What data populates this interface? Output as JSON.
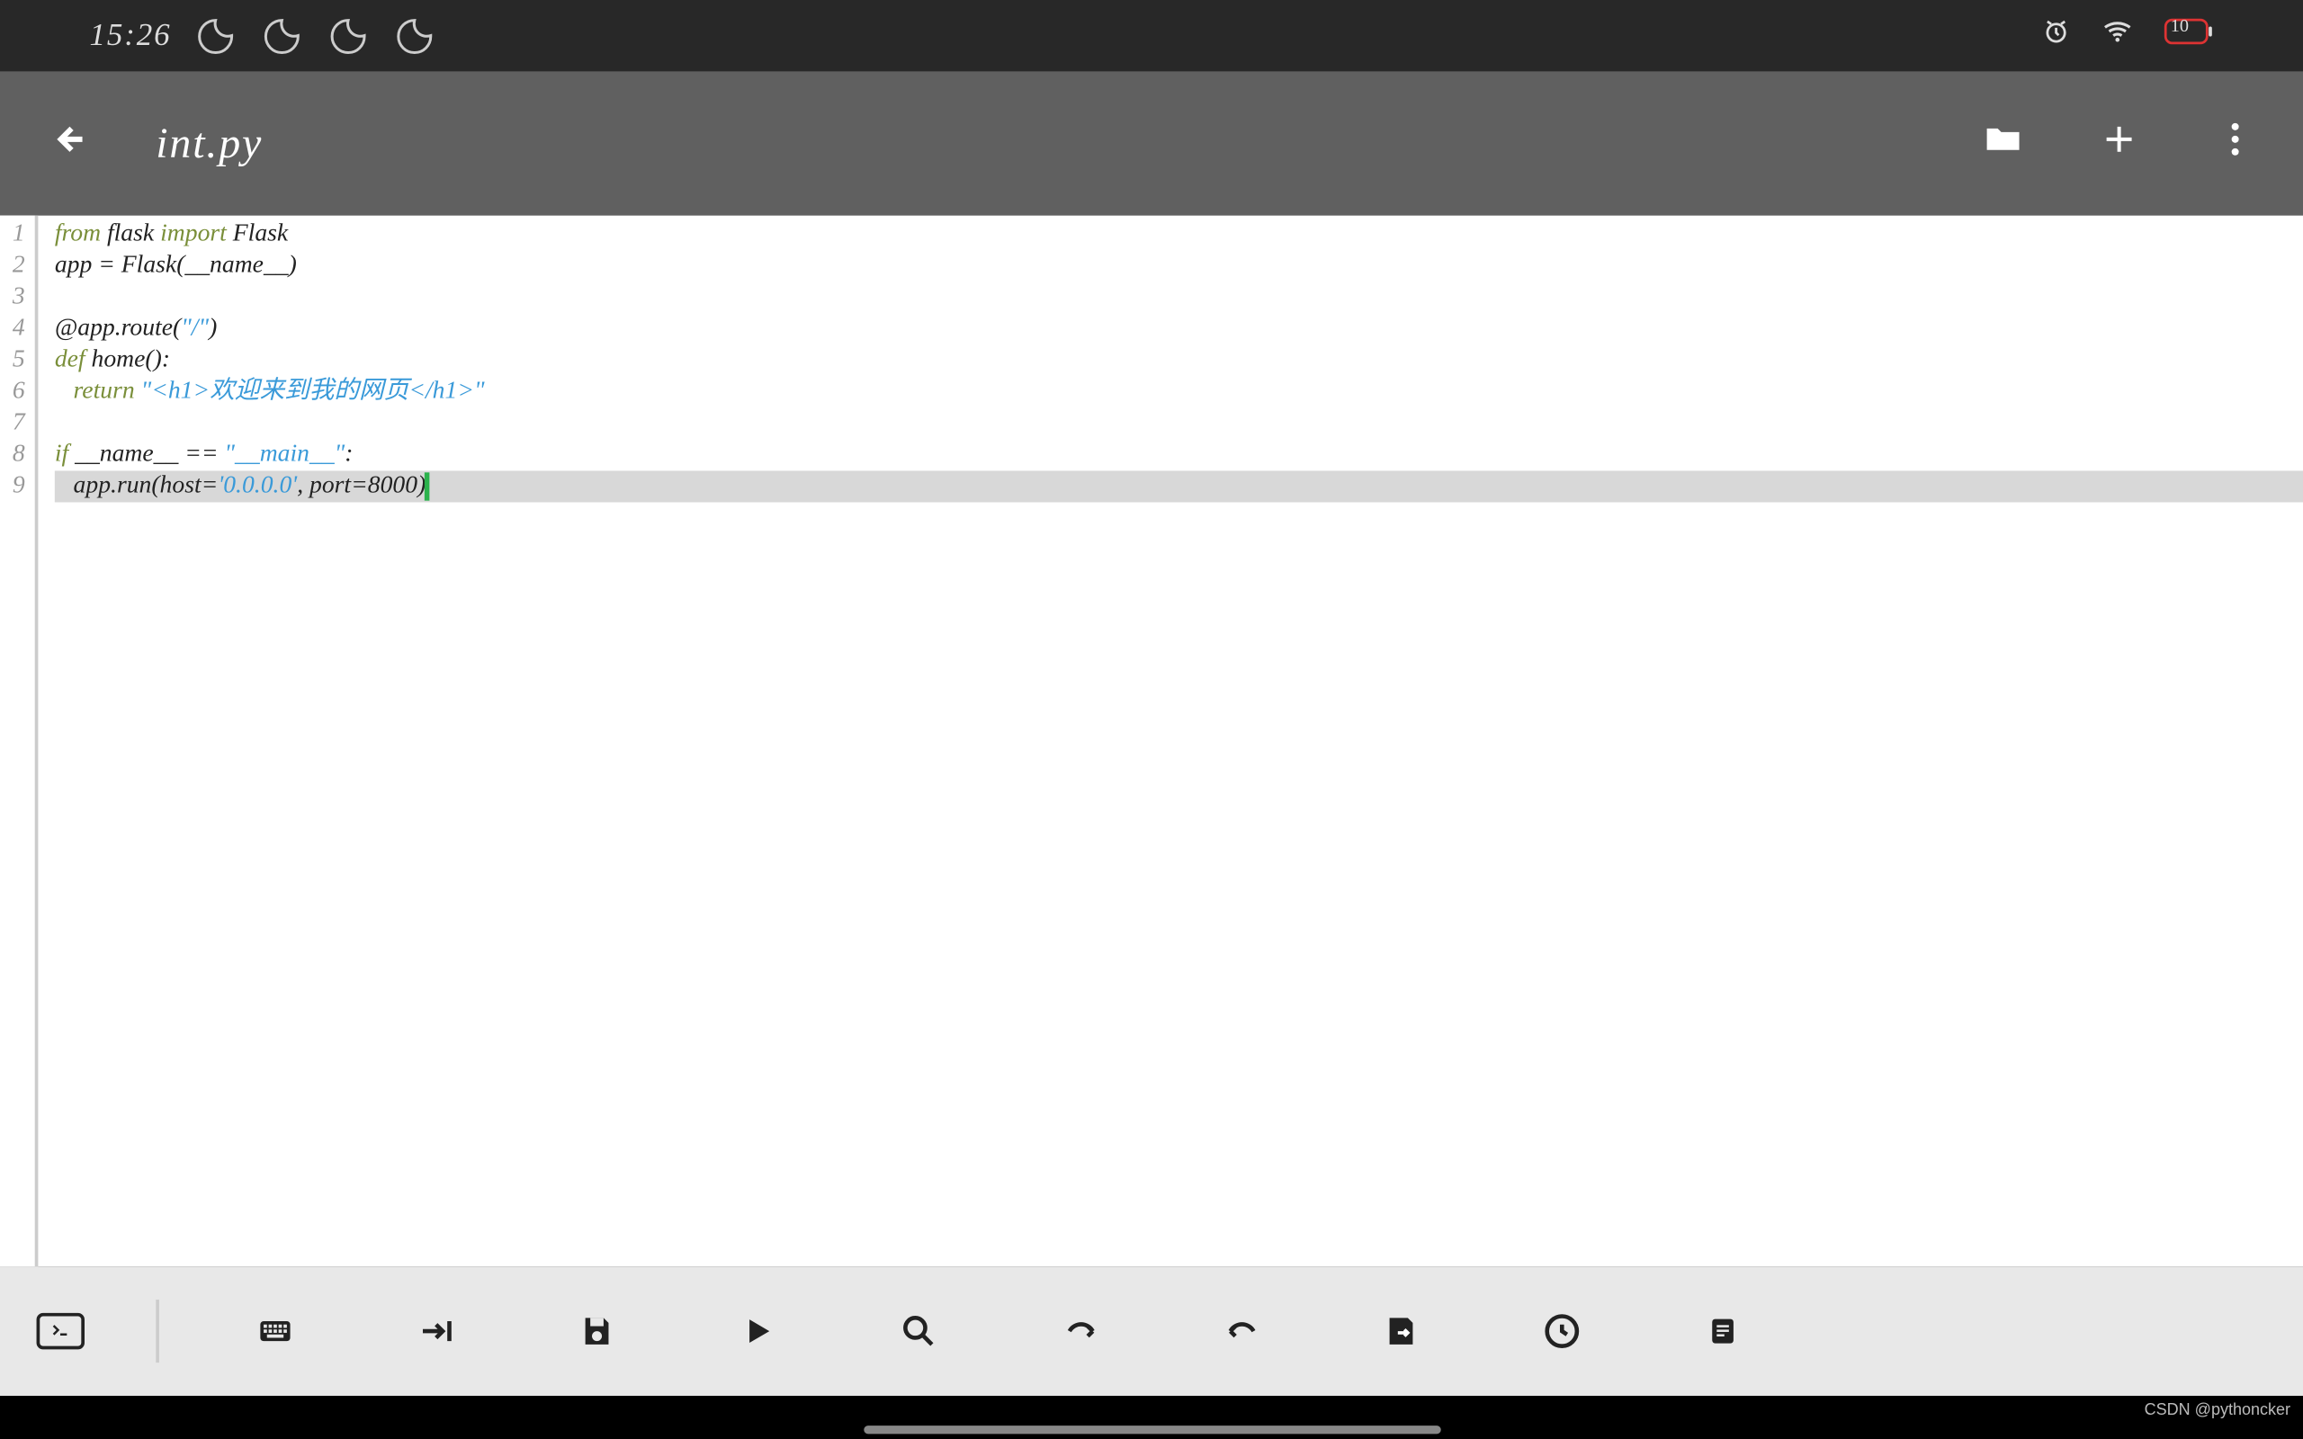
{
  "status": {
    "time": "15:26",
    "battery_level": "10",
    "icons": [
      "moon",
      "moon",
      "moon",
      "moon"
    ]
  },
  "header": {
    "filename": "int.py"
  },
  "editor": {
    "current_line": 9,
    "lines": [
      {
        "n": 1,
        "tokens": [
          [
            "kw1",
            "from"
          ],
          [
            "plain",
            " flask "
          ],
          [
            "kw1",
            "import"
          ],
          [
            "plain",
            " Flask"
          ]
        ]
      },
      {
        "n": 2,
        "tokens": [
          [
            "plain",
            "app = Flask(__name__)"
          ]
        ]
      },
      {
        "n": 3,
        "tokens": [
          [
            "plain",
            ""
          ]
        ]
      },
      {
        "n": 4,
        "tokens": [
          [
            "plain",
            "@app.route("
          ],
          [
            "str",
            "\"/\""
          ],
          [
            "plain",
            ")"
          ]
        ]
      },
      {
        "n": 5,
        "tokens": [
          [
            "kw1",
            "def"
          ],
          [
            "plain",
            " home():"
          ]
        ]
      },
      {
        "n": 6,
        "tokens": [
          [
            "plain",
            "   "
          ],
          [
            "kw1",
            "return"
          ],
          [
            "plain",
            " "
          ],
          [
            "str",
            "\"<h1>欢迎来到我的网页</h1>\""
          ]
        ]
      },
      {
        "n": 7,
        "tokens": [
          [
            "plain",
            ""
          ]
        ]
      },
      {
        "n": 8,
        "tokens": [
          [
            "kw1",
            "if"
          ],
          [
            "plain",
            " __name__ == "
          ],
          [
            "str",
            "\"__main__\""
          ],
          [
            "plain",
            ":"
          ]
        ]
      },
      {
        "n": 9,
        "tokens": [
          [
            "plain",
            "   app.run(host="
          ],
          [
            "str",
            "'0.0.0.0'"
          ],
          [
            "plain",
            ", port="
          ],
          [
            "num",
            "8000"
          ],
          [
            "plain",
            ")"
          ]
        ]
      }
    ]
  },
  "bottom_toolbar": {
    "items": [
      "terminal",
      "sep",
      "keyboard",
      "tab",
      "save",
      "run",
      "search",
      "undo",
      "redo",
      "export",
      "recent",
      "notes"
    ]
  },
  "watermark": "CSDN @pythoncker"
}
